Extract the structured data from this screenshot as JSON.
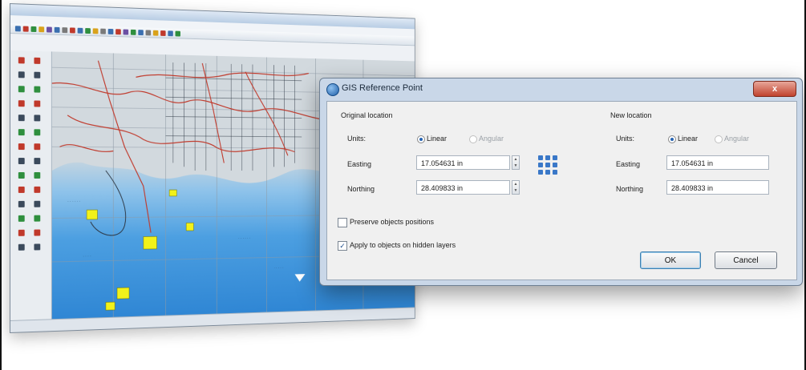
{
  "dialog": {
    "title": "GIS Reference Point",
    "close_label": "x",
    "original": {
      "heading": "Original location",
      "units_label": "Units:",
      "unit_linear": "Linear",
      "unit_angular": "Angular",
      "selected_unit": "Linear",
      "easting_label": "Easting",
      "easting_value": "17.054631 in",
      "northing_label": "Northing",
      "northing_value": "28.409833 in"
    },
    "new": {
      "heading": "New location",
      "units_label": "Units:",
      "unit_linear": "Linear",
      "unit_angular": "Angular",
      "selected_unit": "Linear",
      "easting_label": "Easting",
      "easting_value": "17.054631 in",
      "northing_label": "Northing",
      "northing_value": "28.409833 in"
    },
    "preserve_positions": {
      "label": "Preserve objects positions",
      "checked": false
    },
    "apply_hidden": {
      "label": "Apply to objects on hidden layers",
      "checked": true
    },
    "ok_label": "OK",
    "cancel_label": "Cancel"
  },
  "colors": {
    "accent": "#2563b3",
    "map_sea": "#4c9fe1",
    "map_land": "#d8dfe4",
    "map_roads": "#c0392b",
    "map_parcels": "#f2f21a"
  },
  "icons": [
    "app-logo-icon",
    "gis-globe-icon",
    "reference-grid-icon",
    "close-icon"
  ]
}
